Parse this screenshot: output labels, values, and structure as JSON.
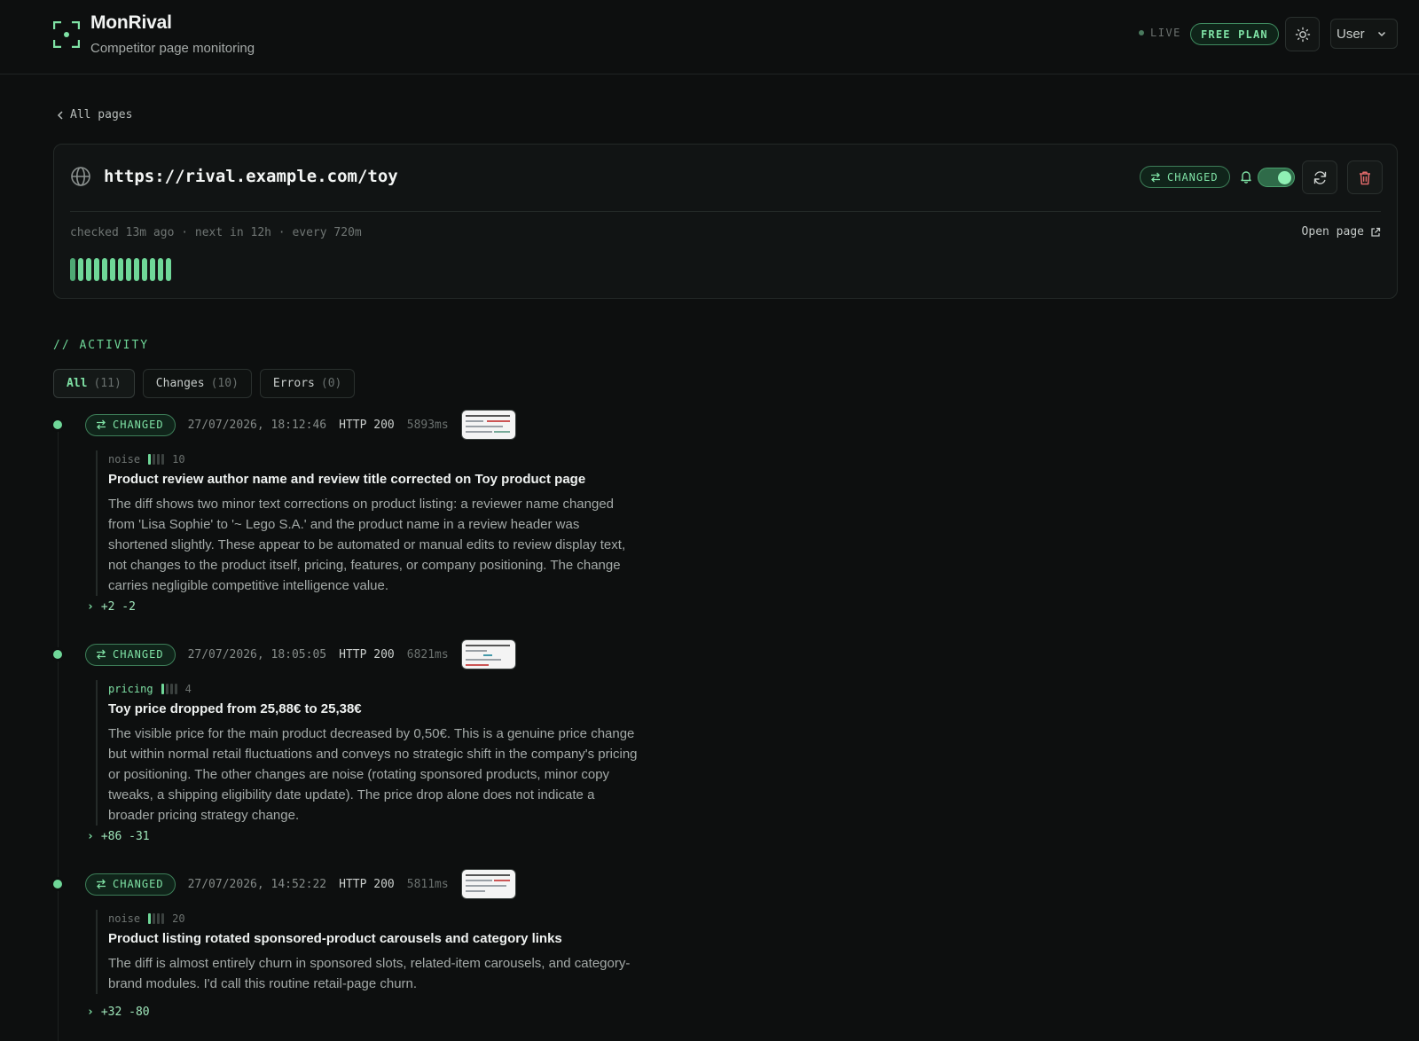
{
  "app": {
    "name": "MonRival",
    "subtitle": "Competitor page monitoring",
    "status": "LIVE",
    "plan": "FREE PLAN",
    "user_label": "User",
    "accent": "#7fe2a5"
  },
  "nav": {
    "back_label": "All pages"
  },
  "page": {
    "url": "https://rival.example.com/toy",
    "status_badge": "CHANGED",
    "notifications_enabled": true,
    "meta": "checked 13m ago · next in 12h · every 720m",
    "open_label": "Open page",
    "check_history": [
      "changed",
      "changed",
      "changed",
      "changed",
      "changed",
      "changed",
      "changed",
      "changed",
      "changed",
      "changed",
      "changed",
      "changed",
      "changed"
    ]
  },
  "activity": {
    "title": "// ACTIVITY",
    "tabs": [
      {
        "label": "All",
        "count": "(11)",
        "active": true
      },
      {
        "label": "Changes",
        "count": "(10)",
        "active": false
      },
      {
        "label": "Errors",
        "count": "(0)",
        "active": false
      }
    ],
    "entries": [
      {
        "badge": "CHANGED",
        "timestamp": "27/07/2026, 18:12:46",
        "http": "HTTP 200",
        "duration": "5893ms",
        "category": "noise",
        "significance": 1,
        "score": "10",
        "title": "Product review author name and review title corrected on Toy product page",
        "description": "The diff shows two minor text corrections on product listing: a reviewer name changed from 'Lisa Sophie' to '~ Lego S.A.' and the product name in a review header was shortened slightly. These appear to be automated or manual edits to review display text, not changes to the product itself, pricing, features, or company positioning. The change carries negligible competitive intelligence value.",
        "diff": "+2 -2"
      },
      {
        "badge": "CHANGED",
        "timestamp": "27/07/2026, 18:05:05",
        "http": "HTTP 200",
        "duration": "6821ms",
        "category": "pricing",
        "significance": 1,
        "score": "4",
        "title": "Toy price dropped from 25,88€ to 25,38€",
        "description": "The visible price for the main product decreased by 0,50€. This is a genuine price change but within normal retail fluctuations and conveys no strategic shift in the company's pricing or positioning. The other changes are noise (rotating sponsored products, minor copy tweaks, a shipping eligibility date update). The price drop alone does not indicate a broader pricing strategy change.",
        "diff": "+86 -31"
      },
      {
        "badge": "CHANGED",
        "timestamp": "27/07/2026, 14:52:22",
        "http": "HTTP 200",
        "duration": "5811ms",
        "category": "noise",
        "significance": 1,
        "score": "20",
        "title": "Product listing rotated sponsored-product carousels and category links",
        "description": "The diff is almost entirely churn in sponsored slots, related-item carousels, and category-brand modules. I'd call this routine retail-page churn.",
        "diff": "+32 -80"
      }
    ]
  }
}
